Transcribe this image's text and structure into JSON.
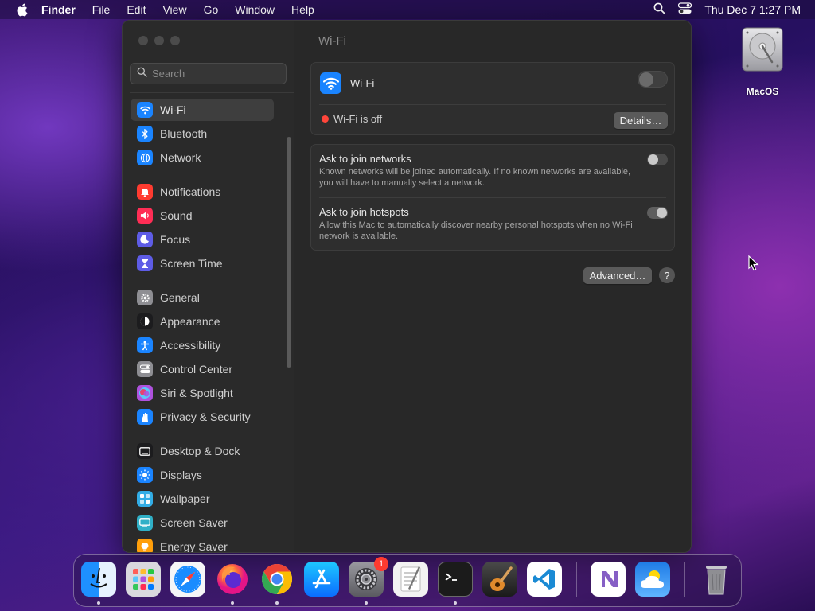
{
  "menubar": {
    "app_name": "Finder",
    "menus": [
      "File",
      "Edit",
      "View",
      "Go",
      "Window",
      "Help"
    ],
    "clock": "Thu Dec 7  1:27 PM"
  },
  "desktop": {
    "disk_label": "MacOS"
  },
  "sidebar": {
    "search_placeholder": "Search",
    "items": [
      {
        "label": "Wi-Fi",
        "icon": "wifi-icon",
        "color": "#1a84ff"
      },
      {
        "label": "Bluetooth",
        "icon": "bluetooth-icon",
        "color": "#1a84ff"
      },
      {
        "label": "Network",
        "icon": "globe-icon",
        "color": "#1a84ff"
      },
      {
        "label": "Notifications",
        "icon": "bell-icon",
        "color": "#ff3b30"
      },
      {
        "label": "Sound",
        "icon": "speaker-icon",
        "color": "#ff2d55"
      },
      {
        "label": "Focus",
        "icon": "moon-icon",
        "color": "#5e5ce6"
      },
      {
        "label": "Screen Time",
        "icon": "hourglass-icon",
        "color": "#5e5ce6"
      },
      {
        "label": "General",
        "icon": "gear-icon",
        "color": "#8e8e93"
      },
      {
        "label": "Appearance",
        "icon": "appearance-icon",
        "color": "#1c1c1e"
      },
      {
        "label": "Accessibility",
        "icon": "accessibility-icon",
        "color": "#1a84ff"
      },
      {
        "label": "Control Center",
        "icon": "control-center-icon",
        "color": "#8e8e93"
      },
      {
        "label": "Siri & Spotlight",
        "icon": "siri-icon",
        "color": "#af52de"
      },
      {
        "label": "Privacy & Security",
        "icon": "hand-icon",
        "color": "#1a84ff"
      },
      {
        "label": "Desktop & Dock",
        "icon": "dock-icon",
        "color": "#1c1c1e"
      },
      {
        "label": "Displays",
        "icon": "sun-icon",
        "color": "#1a84ff"
      },
      {
        "label": "Wallpaper",
        "icon": "wallpaper-icon",
        "color": "#32ade6"
      },
      {
        "label": "Screen Saver",
        "icon": "screen-saver-icon",
        "color": "#30b0c7"
      },
      {
        "label": "Energy Saver",
        "icon": "bulb-icon",
        "color": "#ff9f0a"
      }
    ]
  },
  "content": {
    "title": "Wi-Fi",
    "wifi_label": "Wi-Fi",
    "wifi_on": false,
    "status_text": "Wi-Fi is off",
    "details_button": "Details…",
    "ask_networks_title": "Ask to join networks",
    "ask_networks_desc": "Known networks will be joined automatically. If no known networks are available, you will have to manually select a network.",
    "ask_networks_on": false,
    "ask_hotspots_title": "Ask to join hotspots",
    "ask_hotspots_desc": "Allow this Mac to automatically discover nearby personal hotspots when no Wi-Fi network is available.",
    "ask_hotspots_on": true,
    "advanced_button": "Advanced…",
    "help_button": "?"
  },
  "dock": {
    "system_settings_badge": "1",
    "apps": [
      "finder-icon",
      "launchpad-icon",
      "safari-icon",
      "firefox-icon",
      "chrome-icon",
      "app-store-icon",
      "system-settings-icon",
      "textedit-icon",
      "terminal-icon",
      "garageband-icon",
      "vscode-icon",
      "visual-studio-icon",
      "weather-icon",
      "trash-icon"
    ]
  }
}
